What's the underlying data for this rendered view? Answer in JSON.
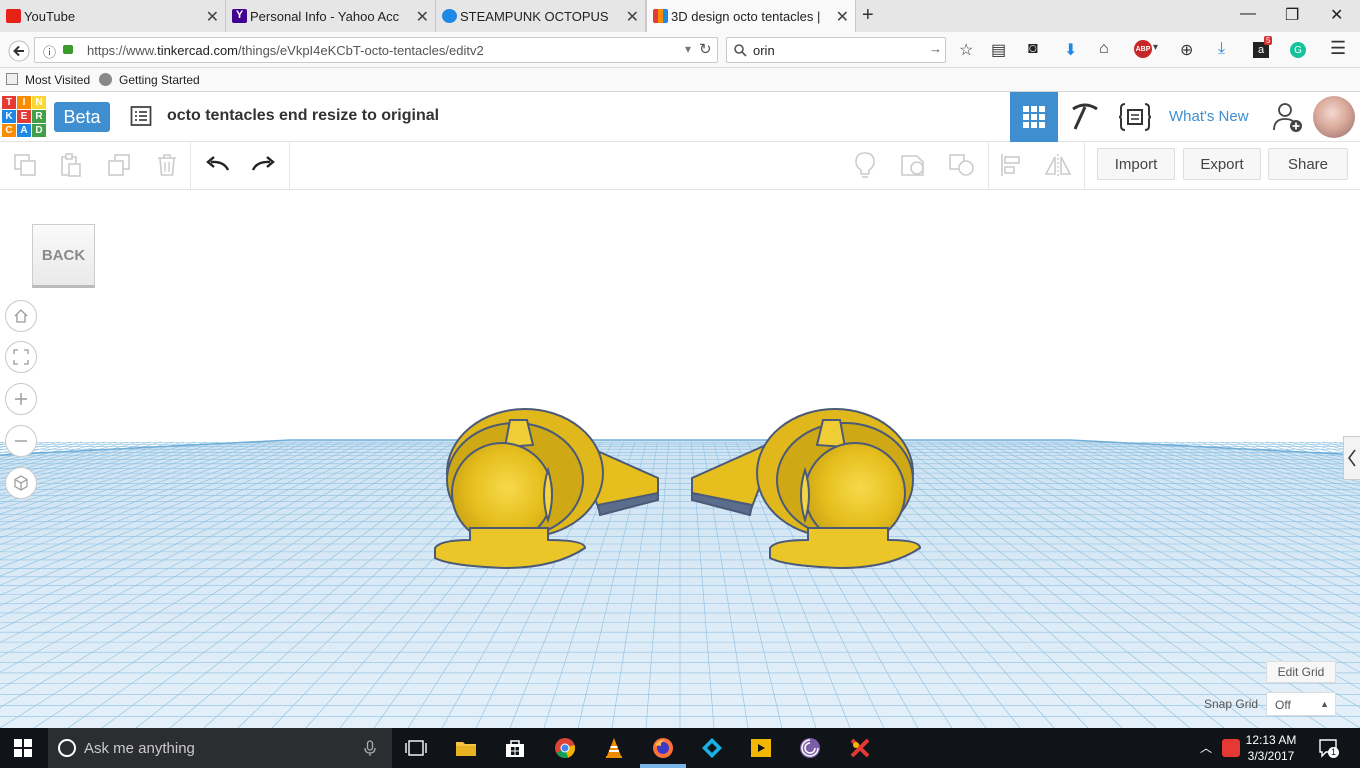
{
  "browser": {
    "tabs": [
      {
        "title": "YouTube",
        "icon": "youtube-icon",
        "color": "#e62117"
      },
      {
        "title": "Personal Info - Yahoo Acc...",
        "icon": "yahoo-icon",
        "color": "#400090"
      },
      {
        "title": "STEAMPUNK OCTOPUS T...",
        "icon": "tinkercad-circle-icon",
        "color": "#1e88e5"
      },
      {
        "title": "3D design octo tentacles | ...",
        "icon": "tinkercad-grid-icon",
        "color": "#e53935"
      }
    ],
    "url_prefix": "https://www.",
    "url_domain": "tinkercad.com",
    "url_path": "/things/eVkpI4eKCbT-octo-tentacles/editv2",
    "search_value": "orin",
    "adblock_badge": "ABP",
    "notif_badge": "5"
  },
  "bookmarks": [
    {
      "label": "Most Visited"
    },
    {
      "label": "Getting Started"
    }
  ],
  "tinkercad": {
    "logo_letters": [
      "T",
      "I",
      "N",
      "K",
      "E",
      "R",
      "C",
      "A",
      "D"
    ],
    "logo_colors": [
      "#e53935",
      "#fb8c00",
      "#fdd835",
      "#1e88e5",
      "#e53935",
      "#43a047",
      "#fb8c00",
      "#1e88e5",
      "#43a047"
    ],
    "beta_label": "Beta",
    "design_title": "octo tentacles end resize to original",
    "whats_new": "What's New",
    "import_label": "Import",
    "export_label": "Export",
    "share_label": "Share",
    "accent": "#3e8ed0"
  },
  "workplane": {
    "back_label": "BACK",
    "edit_grid_label": "Edit Grid",
    "snap_grid_label": "Snap Grid",
    "snap_grid_value": "Off",
    "shape_color": "#e8c41f"
  },
  "taskbar": {
    "search_placeholder": "Ask me anything",
    "time": "12:13 AM",
    "date": "3/3/2017",
    "notification_count": "1"
  }
}
